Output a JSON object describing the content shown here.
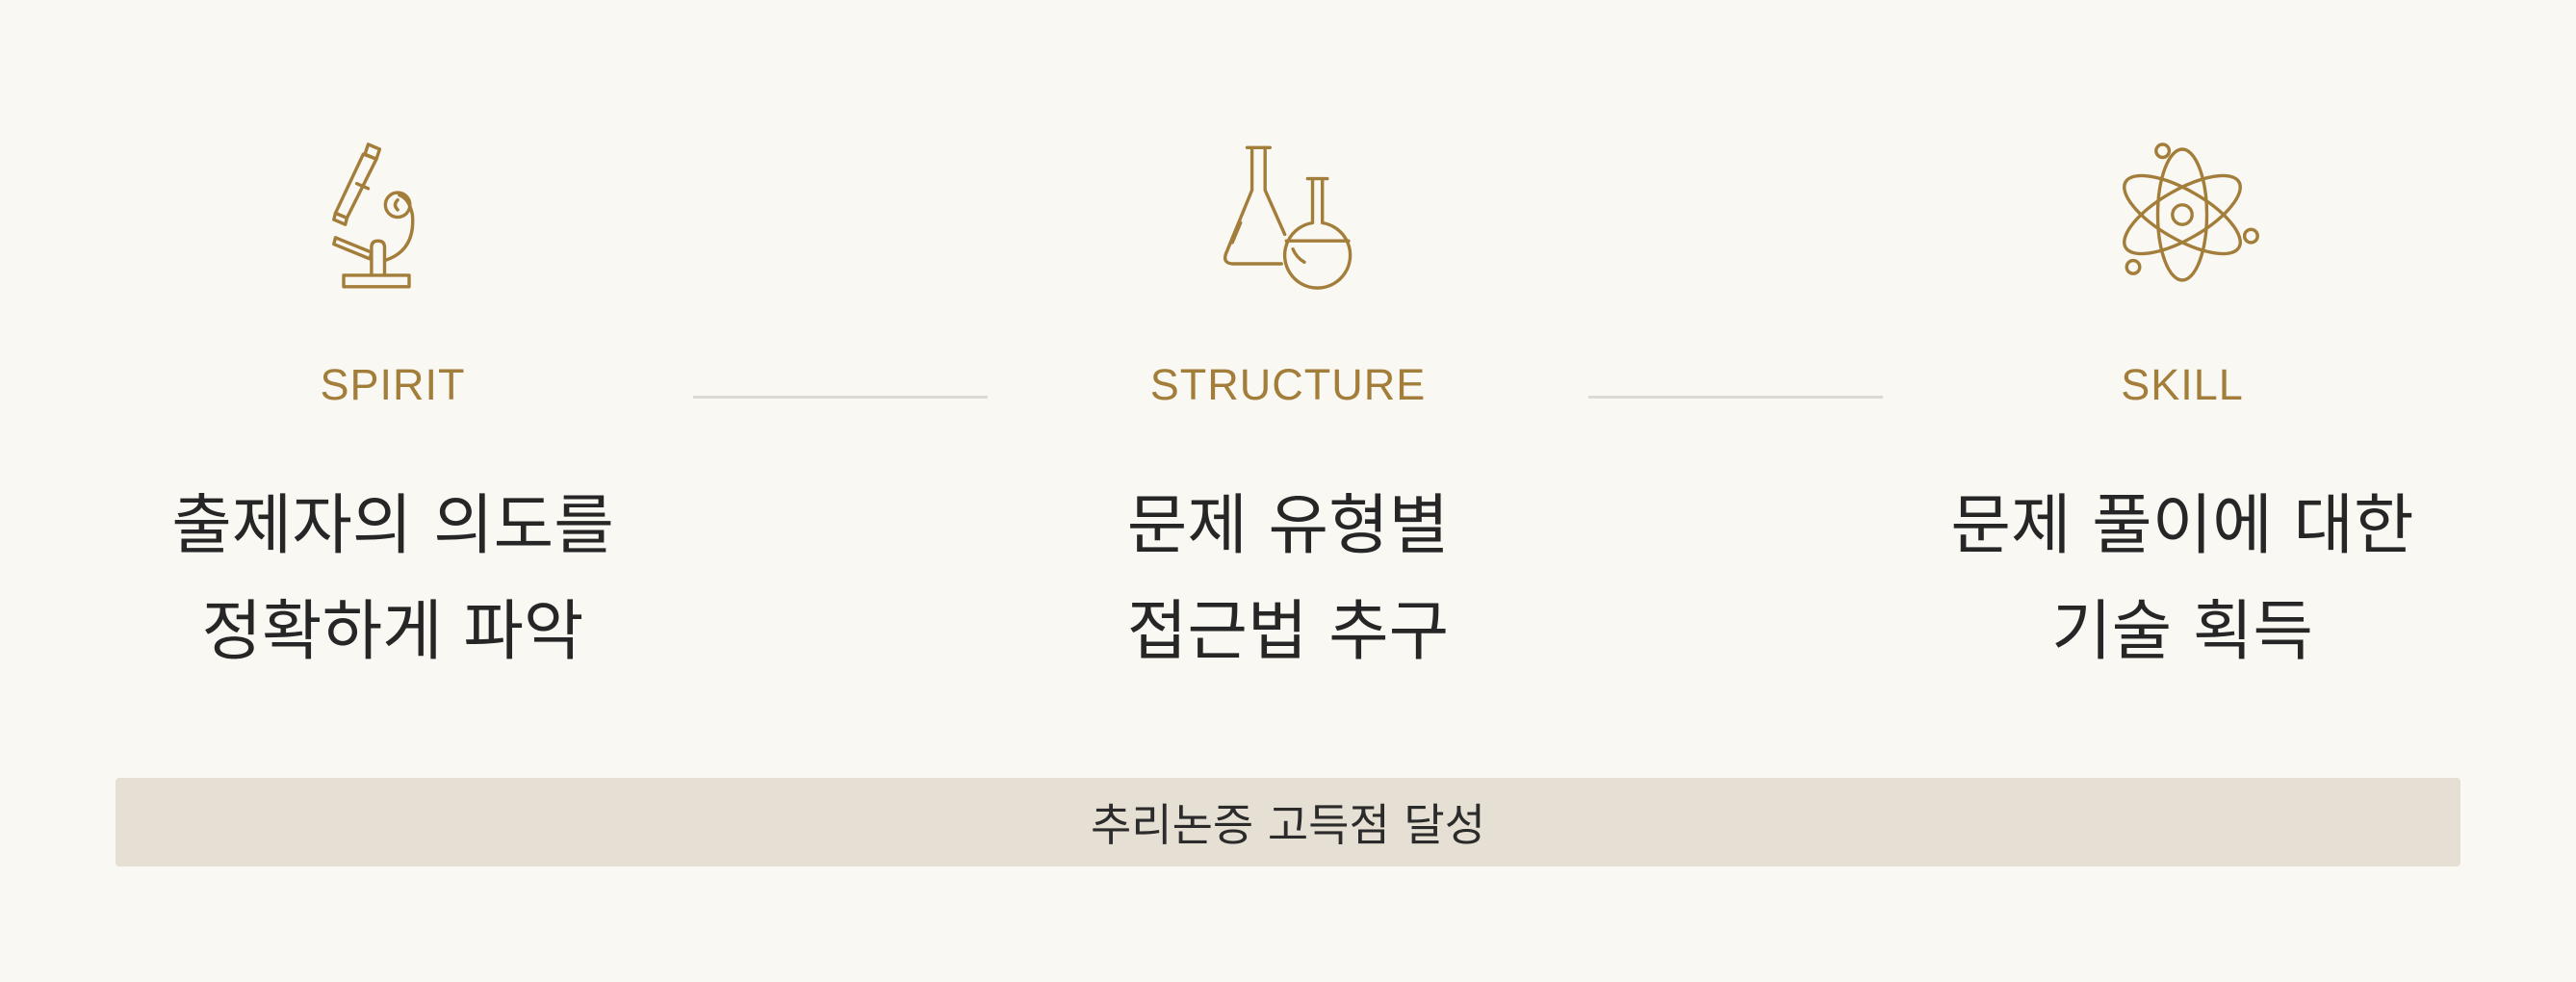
{
  "pillars": [
    {
      "icon": "microscope-icon",
      "label": "SPIRIT",
      "line1": "출제자의 의도를",
      "line2": "정확하게 파악"
    },
    {
      "icon": "flasks-icon",
      "label": "STRUCTURE",
      "line1": "문제 유형별",
      "line2": "접근법 추구"
    },
    {
      "icon": "atom-icon",
      "label": "SKILL",
      "line1": "문제 풀이에 대한",
      "line2": "기술 획득"
    }
  ],
  "summary": "추리논증 고득점 달성",
  "colors": {
    "accent": "#a37d3a",
    "background": "#faf8f3",
    "summary_bar": "#e6dfd4",
    "connector": "#dcdad2",
    "text": "#262626"
  }
}
